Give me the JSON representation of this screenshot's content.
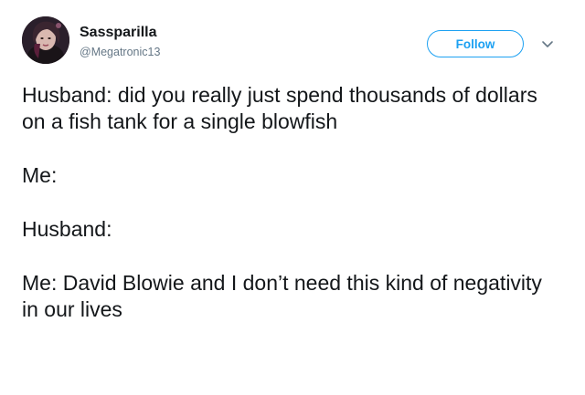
{
  "author": {
    "display_name": "Sassparilla",
    "handle": "@Megatronic13"
  },
  "actions": {
    "follow_label": "Follow",
    "menu_icon": "chevron-down-icon"
  },
  "tweet": {
    "paragraphs": [
      "Husband: did you really just spend thousands of dollars on a fish tank for a single blowfish",
      "Me:",
      "Husband:",
      "Me: David Blowie and I don’t need this kind of negativity in our lives"
    ]
  },
  "colors": {
    "accent": "#1da1f2",
    "text": "#14171a",
    "secondary_text": "#657786"
  }
}
